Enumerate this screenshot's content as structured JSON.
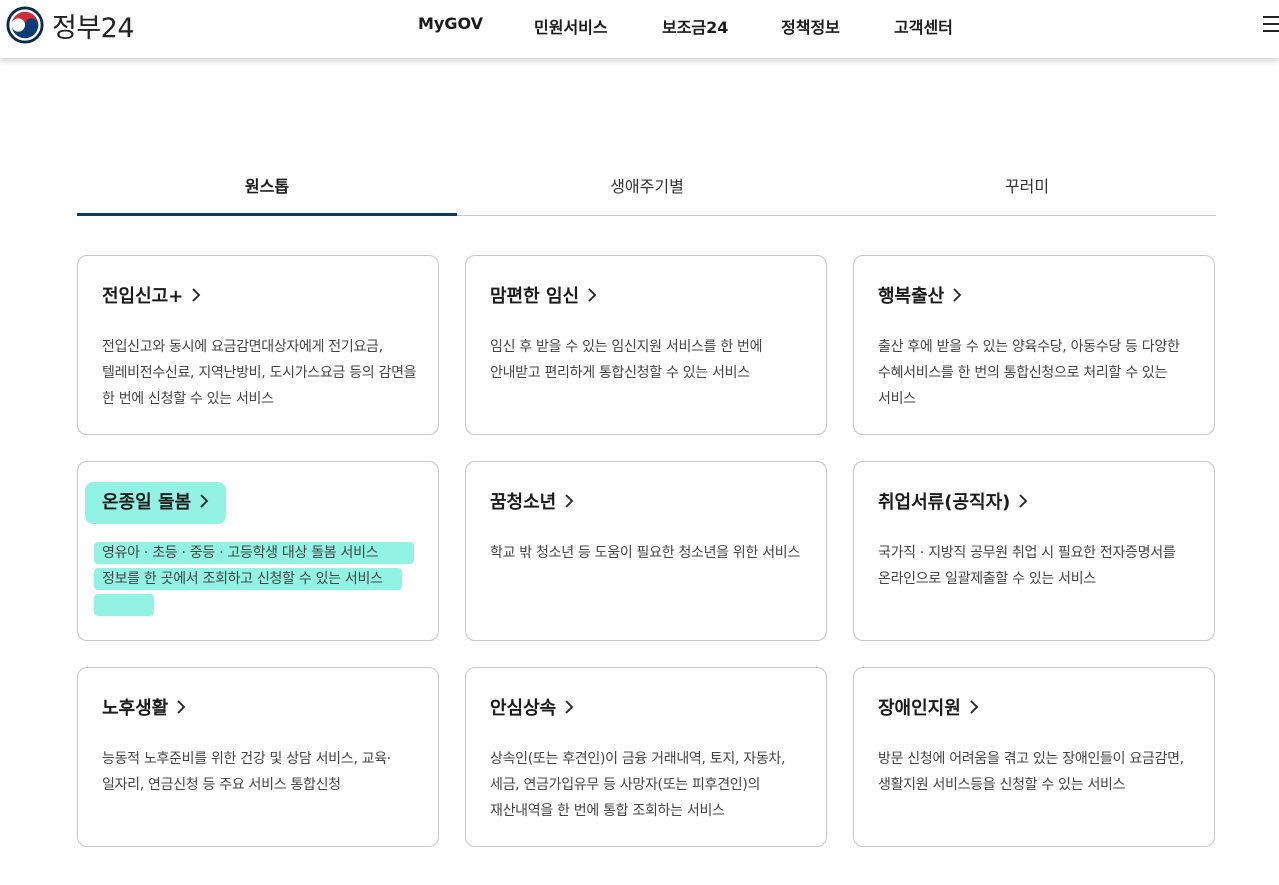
{
  "header": {
    "logo_text": "정부24",
    "nav": [
      "MyGOV",
      "민원서비스",
      "보조금24",
      "정책정보",
      "고객센터"
    ],
    "menu_icon": "hamburger-menu-icon"
  },
  "tabs": [
    {
      "label": "원스톱",
      "active": true
    },
    {
      "label": "생애주기별",
      "active": false
    },
    {
      "label": "꾸러미",
      "active": false
    }
  ],
  "cards": [
    {
      "title": "전입신고+",
      "desc": "전입신고와 동시에 요금감면대상자에게 전기요금, 텔레비전수신료, 지역난방비, 도시가스요금 등의 감면을 한 번에 신청할 수 있는 서비스"
    },
    {
      "title": "맘편한 임신",
      "desc": "임신 후 받을 수 있는 임신지원 서비스를 한 번에 안내받고 편리하게 통합신청할 수 있는 서비스"
    },
    {
      "title": "행복출산",
      "desc": "출산 후에 받을 수 있는 양육수당, 아동수당 등 다양한 수혜서비스를 한 번의 통합신청으로 처리할 수 있는 서비스"
    },
    {
      "title": "온종일 돌봄",
      "desc": "영유아 · 초등 · 중등 · 고등학생 대상 돌봄 서비스 정보를 한 곳에서 조회하고 신청할 수 있는 서비스",
      "highlighted": true
    },
    {
      "title": "꿈청소년",
      "desc": "학교 밖 청소년 등 도움이 필요한 청소년을 위한 서비스"
    },
    {
      "title": "취업서류(공직자)",
      "desc": "국가직 · 지방직 공무원 취업 시 필요한 전자증명서를 온라인으로 일괄제출할 수 있는 서비스"
    },
    {
      "title": "노후생활",
      "desc": "능동적 노후준비를 위한 건강 및 상담 서비스, 교육·일자리, 연금신청 등 주요 서비스 통합신청"
    },
    {
      "title": "안심상속",
      "desc": "상속인(또는 후견인)이 금융 거래내역, 토지, 자동차, 세금, 연금가입유무 등 사망자(또는 피후견인)의 재산내역을 한 번에 통합 조회하는 서비스"
    },
    {
      "title": "장애인지원",
      "desc": "방문 신청에 어려움을 겪고 있는 장애인들이 요금감면, 생활지원 서비스등을 신청할 수 있는 서비스"
    }
  ],
  "colors": {
    "accent": "#0b3b63",
    "highlight": "#7ff0df",
    "card_border": "#c8c8c8"
  }
}
